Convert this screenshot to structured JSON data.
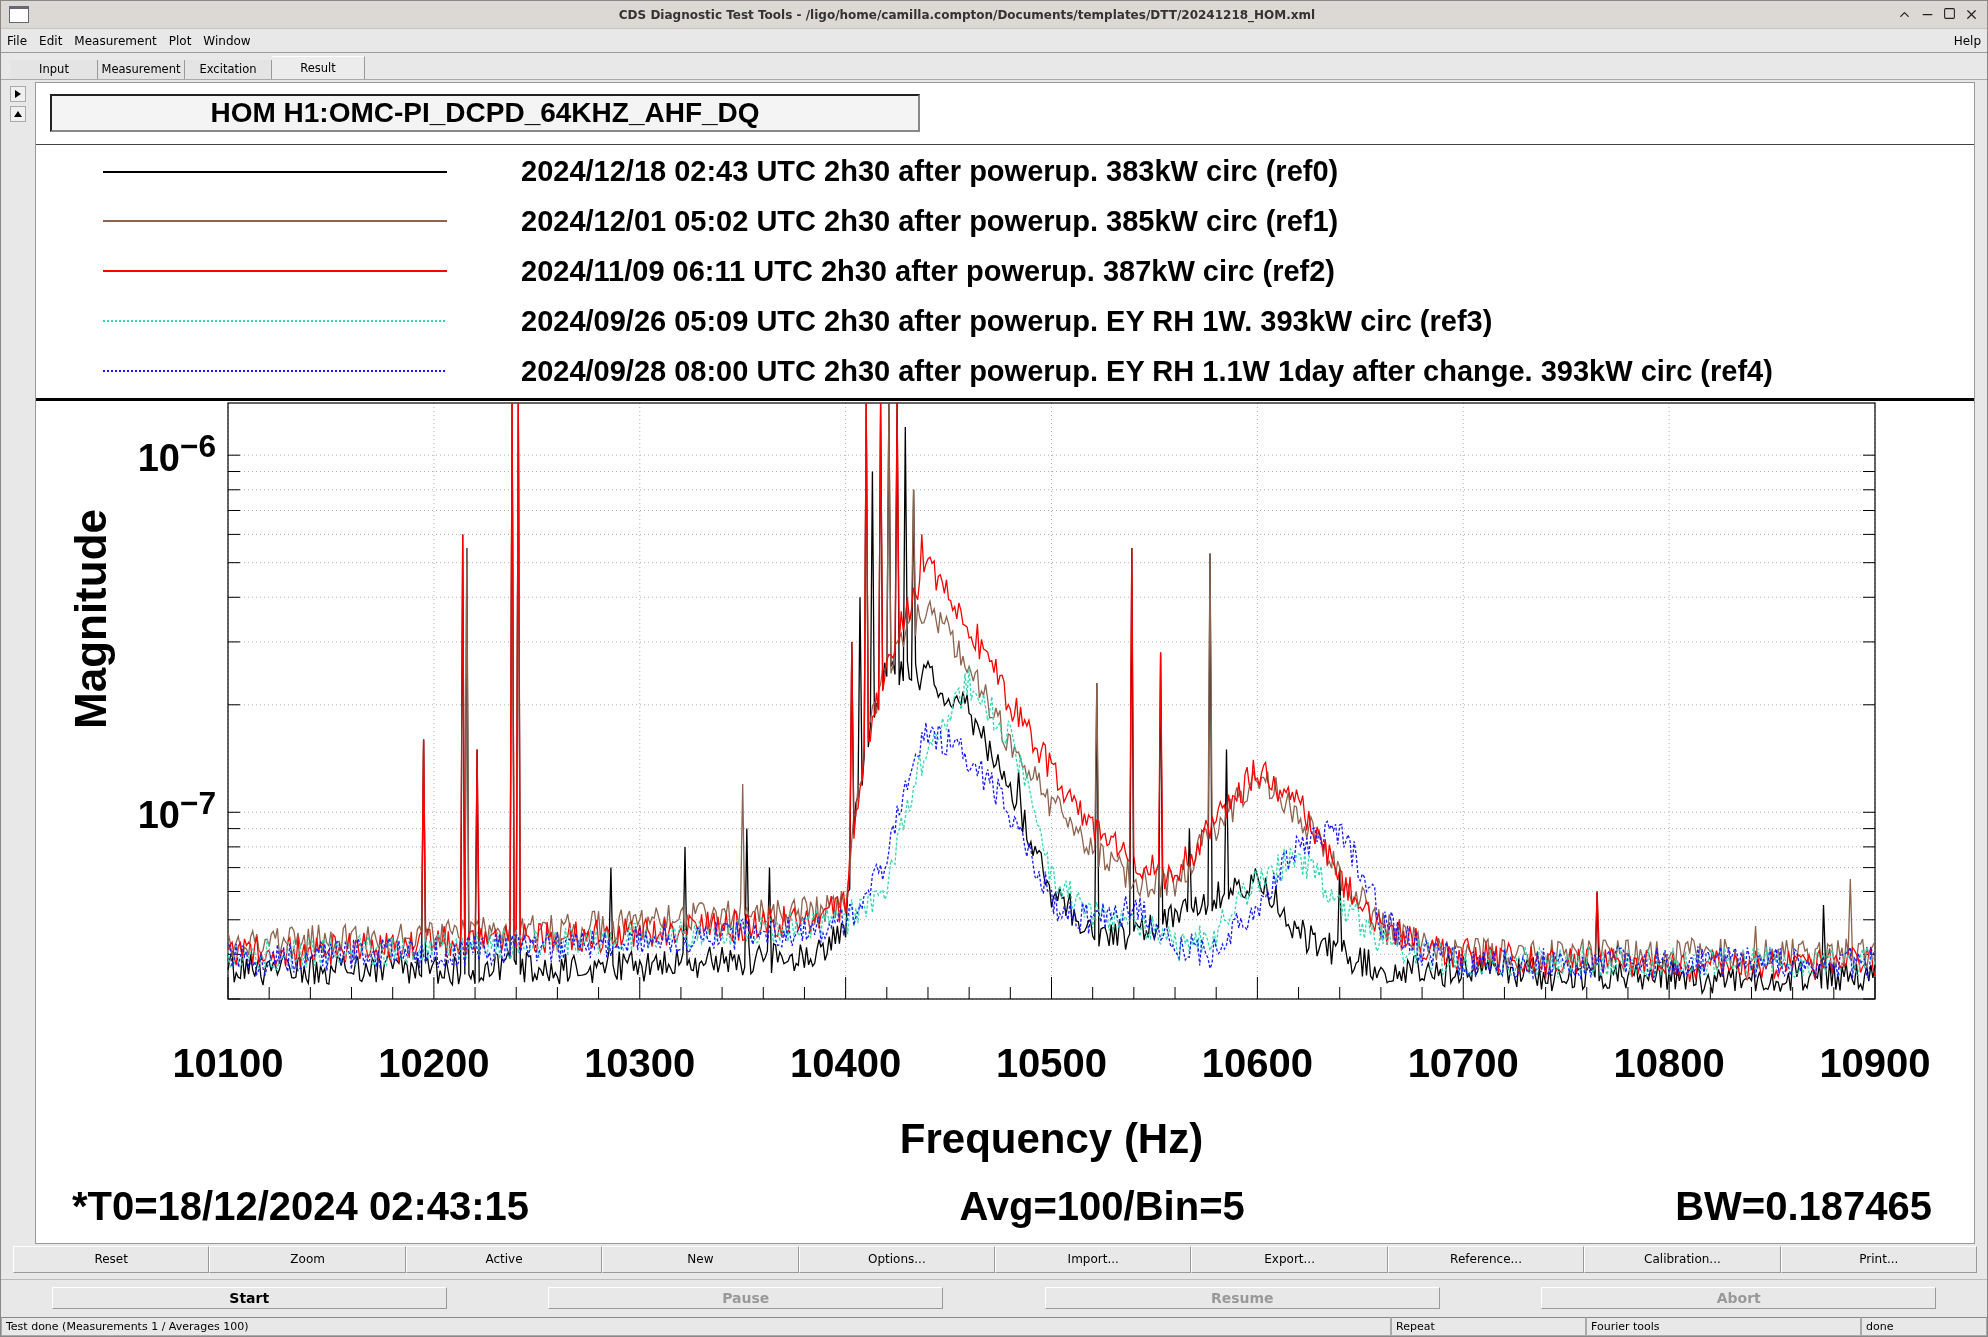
{
  "window": {
    "title": "CDS Diagnostic Test Tools - /ligo/home/camilla.compton/Documents/templates/DTT/20241218_HOM.xml"
  },
  "menu": {
    "items": [
      "File",
      "Edit",
      "Measurement",
      "Plot",
      "Window"
    ],
    "help": "Help"
  },
  "tabs": [
    {
      "label": "Input",
      "selected": false
    },
    {
      "label": "Measurement",
      "selected": false
    },
    {
      "label": "Excitation",
      "selected": false
    },
    {
      "label": "Result",
      "selected": true
    }
  ],
  "plot": {
    "title": "HOM H1:OMC-PI_DCPD_64KHZ_AHF_DQ",
    "legend": [
      {
        "label": "2024/12/18 02:43 UTC 2h30 after powerup. 383kW circ (ref0)",
        "color": "#000000",
        "dotted": false
      },
      {
        "label": "2024/12/01 05:02 UTC 2h30 after powerup. 385kW circ (ref1)",
        "color": "#8c6450",
        "dotted": false
      },
      {
        "label": "2024/11/09 06:11 UTC 2h30 after powerup. 387kW circ (ref2)",
        "color": "#ff0000",
        "dotted": false
      },
      {
        "label": "2024/09/26 05:09 UTC 2h30 after powerup. EY RH 1W. 393kW circ (ref3)",
        "color": "#30d8b0",
        "dotted": true
      },
      {
        "label": "2024/09/28 08:00 UTC 2h30 after powerup. EY RH 1.1W 1day after change. 393kW circ (ref4)",
        "color": "#1a1aff",
        "dotted": true
      }
    ],
    "x_ticks": [
      "10100",
      "10200",
      "10300",
      "10400",
      "10500",
      "10600",
      "10700",
      "10800",
      "10900"
    ],
    "y_ticks": [
      "10$^{−6}$",
      "10$^{−7}$"
    ],
    "xlabel": "Frequency (Hz)",
    "ylabel": "Magnitude",
    "footer": [
      "*T0=18/12/2024 02:43:15",
      "Avg=100/Bin=5",
      "BW=0.187465"
    ]
  },
  "plot_buttons": [
    "Reset",
    "Zoom",
    "Active",
    "New",
    "Options...",
    "Import...",
    "Export...",
    "Reference...",
    "Calibration...",
    "Print..."
  ],
  "run_buttons": [
    {
      "label": "Start",
      "disabled": false
    },
    {
      "label": "Pause",
      "disabled": true
    },
    {
      "label": "Resume",
      "disabled": true
    },
    {
      "label": "Abort",
      "disabled": true
    }
  ],
  "status_bar": [
    "Test done (Measurements 1 / Averages 100)",
    "Repeat",
    "Fourier tools",
    "done"
  ]
}
